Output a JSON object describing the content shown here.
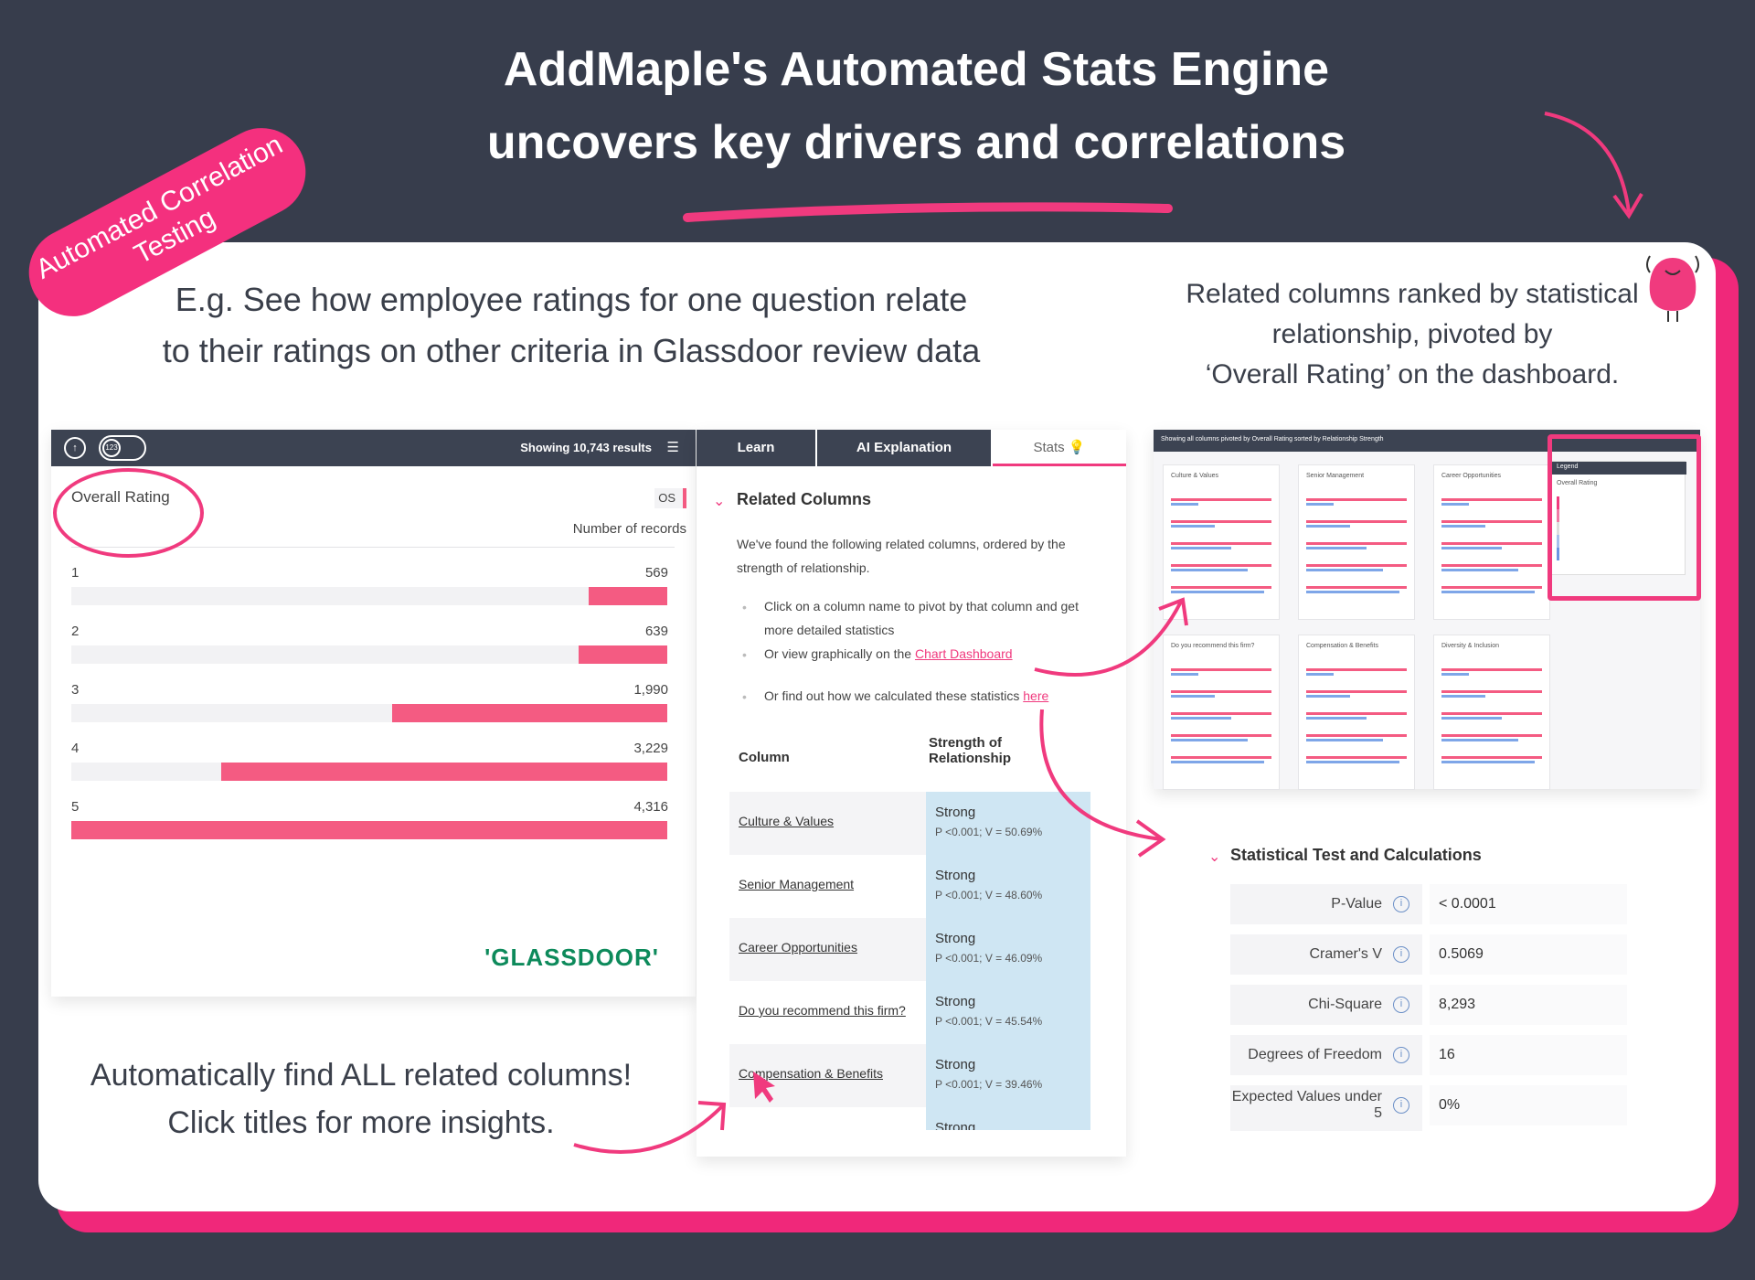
{
  "headline": {
    "line1": "AddMaple's Automated Stats Engine",
    "line2": "uncovers key drivers and correlations"
  },
  "badge": {
    "line1": "Automated Correlation",
    "line2": "Testing"
  },
  "captions": {
    "eg_line1": "E.g. See how employee ratings for one question relate",
    "eg_line2": "to their ratings on other criteria in Glassdoor review data",
    "ranked_line1": "Related columns ranked by statistical",
    "ranked_line2": "relationship, pivoted by",
    "ranked_line3": "‘Overall Rating’ on the dashboard.",
    "auto_line1": "Automatically find ALL related columns!",
    "auto_line2": "Click titles for more insights."
  },
  "chart_panel": {
    "toggle_label": "123",
    "showing": "Showing 10,743 results",
    "title": "Overall Rating",
    "os_tag": "OS",
    "records_label": "Number of records",
    "logo": "'GLASSDOOR'"
  },
  "chart_data": {
    "type": "bar",
    "title": "Overall Rating",
    "ylabel": "Number of records",
    "categories": [
      "1",
      "2",
      "3",
      "4",
      "5"
    ],
    "values": [
      569,
      639,
      1990,
      3229,
      4316
    ],
    "value_labels": [
      "569",
      "639",
      "1,990",
      "3,229",
      "4,316"
    ],
    "orientation": "horizontal",
    "bar_color": "#f45b82"
  },
  "related_panel": {
    "tabs": [
      "Learn",
      "AI Explanation",
      "Stats"
    ],
    "heading": "Related Columns",
    "intro": "We've found the following related columns, ordered by the strength of relationship.",
    "bullet1": "Click on a column name to pivot by that column and get more detailed statistics",
    "bullet2_prefix": "Or view graphically on the ",
    "bullet2_link": "Chart Dashboard",
    "bullet3_prefix": "Or find out how we calculated these statistics ",
    "bullet3_link": "here",
    "col_header": "Column",
    "strength_header_1": "Strength of",
    "strength_header_2": "Relationship",
    "rows": [
      {
        "name": "Culture & Values",
        "strength": "Strong",
        "stat": "P <0.001; V = 50.69%"
      },
      {
        "name": "Senior Management",
        "strength": "Strong",
        "stat": "P <0.001; V = 48.60%"
      },
      {
        "name": "Career Opportunities",
        "strength": "Strong",
        "stat": "P <0.001; V = 46.09%"
      },
      {
        "name": "Do you recommend this firm?",
        "strength": "Strong",
        "stat": "P <0.001; V = 45.54%"
      },
      {
        "name": "Compensation & Benefits",
        "strength": "Strong",
        "stat": "P <0.001; V = 39.46%"
      },
      {
        "name": "Diversity & Inclusion",
        "strength": "Strong",
        "stat": ""
      }
    ]
  },
  "dashboard": {
    "topbar": "Showing all columns pivoted by  Overall Rating   sorted by  Relationship Strength",
    "cards": [
      "Culture & Values",
      "Senior Management",
      "Career Opportunities",
      "Do you recommend this firm?",
      "Compensation & Benefits",
      "Diversity & Inclusion"
    ],
    "legend_title": "Legend",
    "legend_sub": "Overall Rating"
  },
  "stats_panel": {
    "heading": "Statistical Test and Calculations",
    "rows": [
      {
        "label": "P-Value",
        "value": "< 0.0001"
      },
      {
        "label": "Cramer's V",
        "value": "0.5069"
      },
      {
        "label": "Chi-Square",
        "value": "8,293"
      },
      {
        "label": "Degrees of Freedom",
        "value": "16"
      },
      {
        "label": "Expected Values under 5",
        "value": "0%"
      }
    ]
  },
  "colors": {
    "accent": "#f03a7e",
    "background": "#373d4c",
    "bar": "#f45b82",
    "highlight_cell": "#cfe6f3"
  }
}
